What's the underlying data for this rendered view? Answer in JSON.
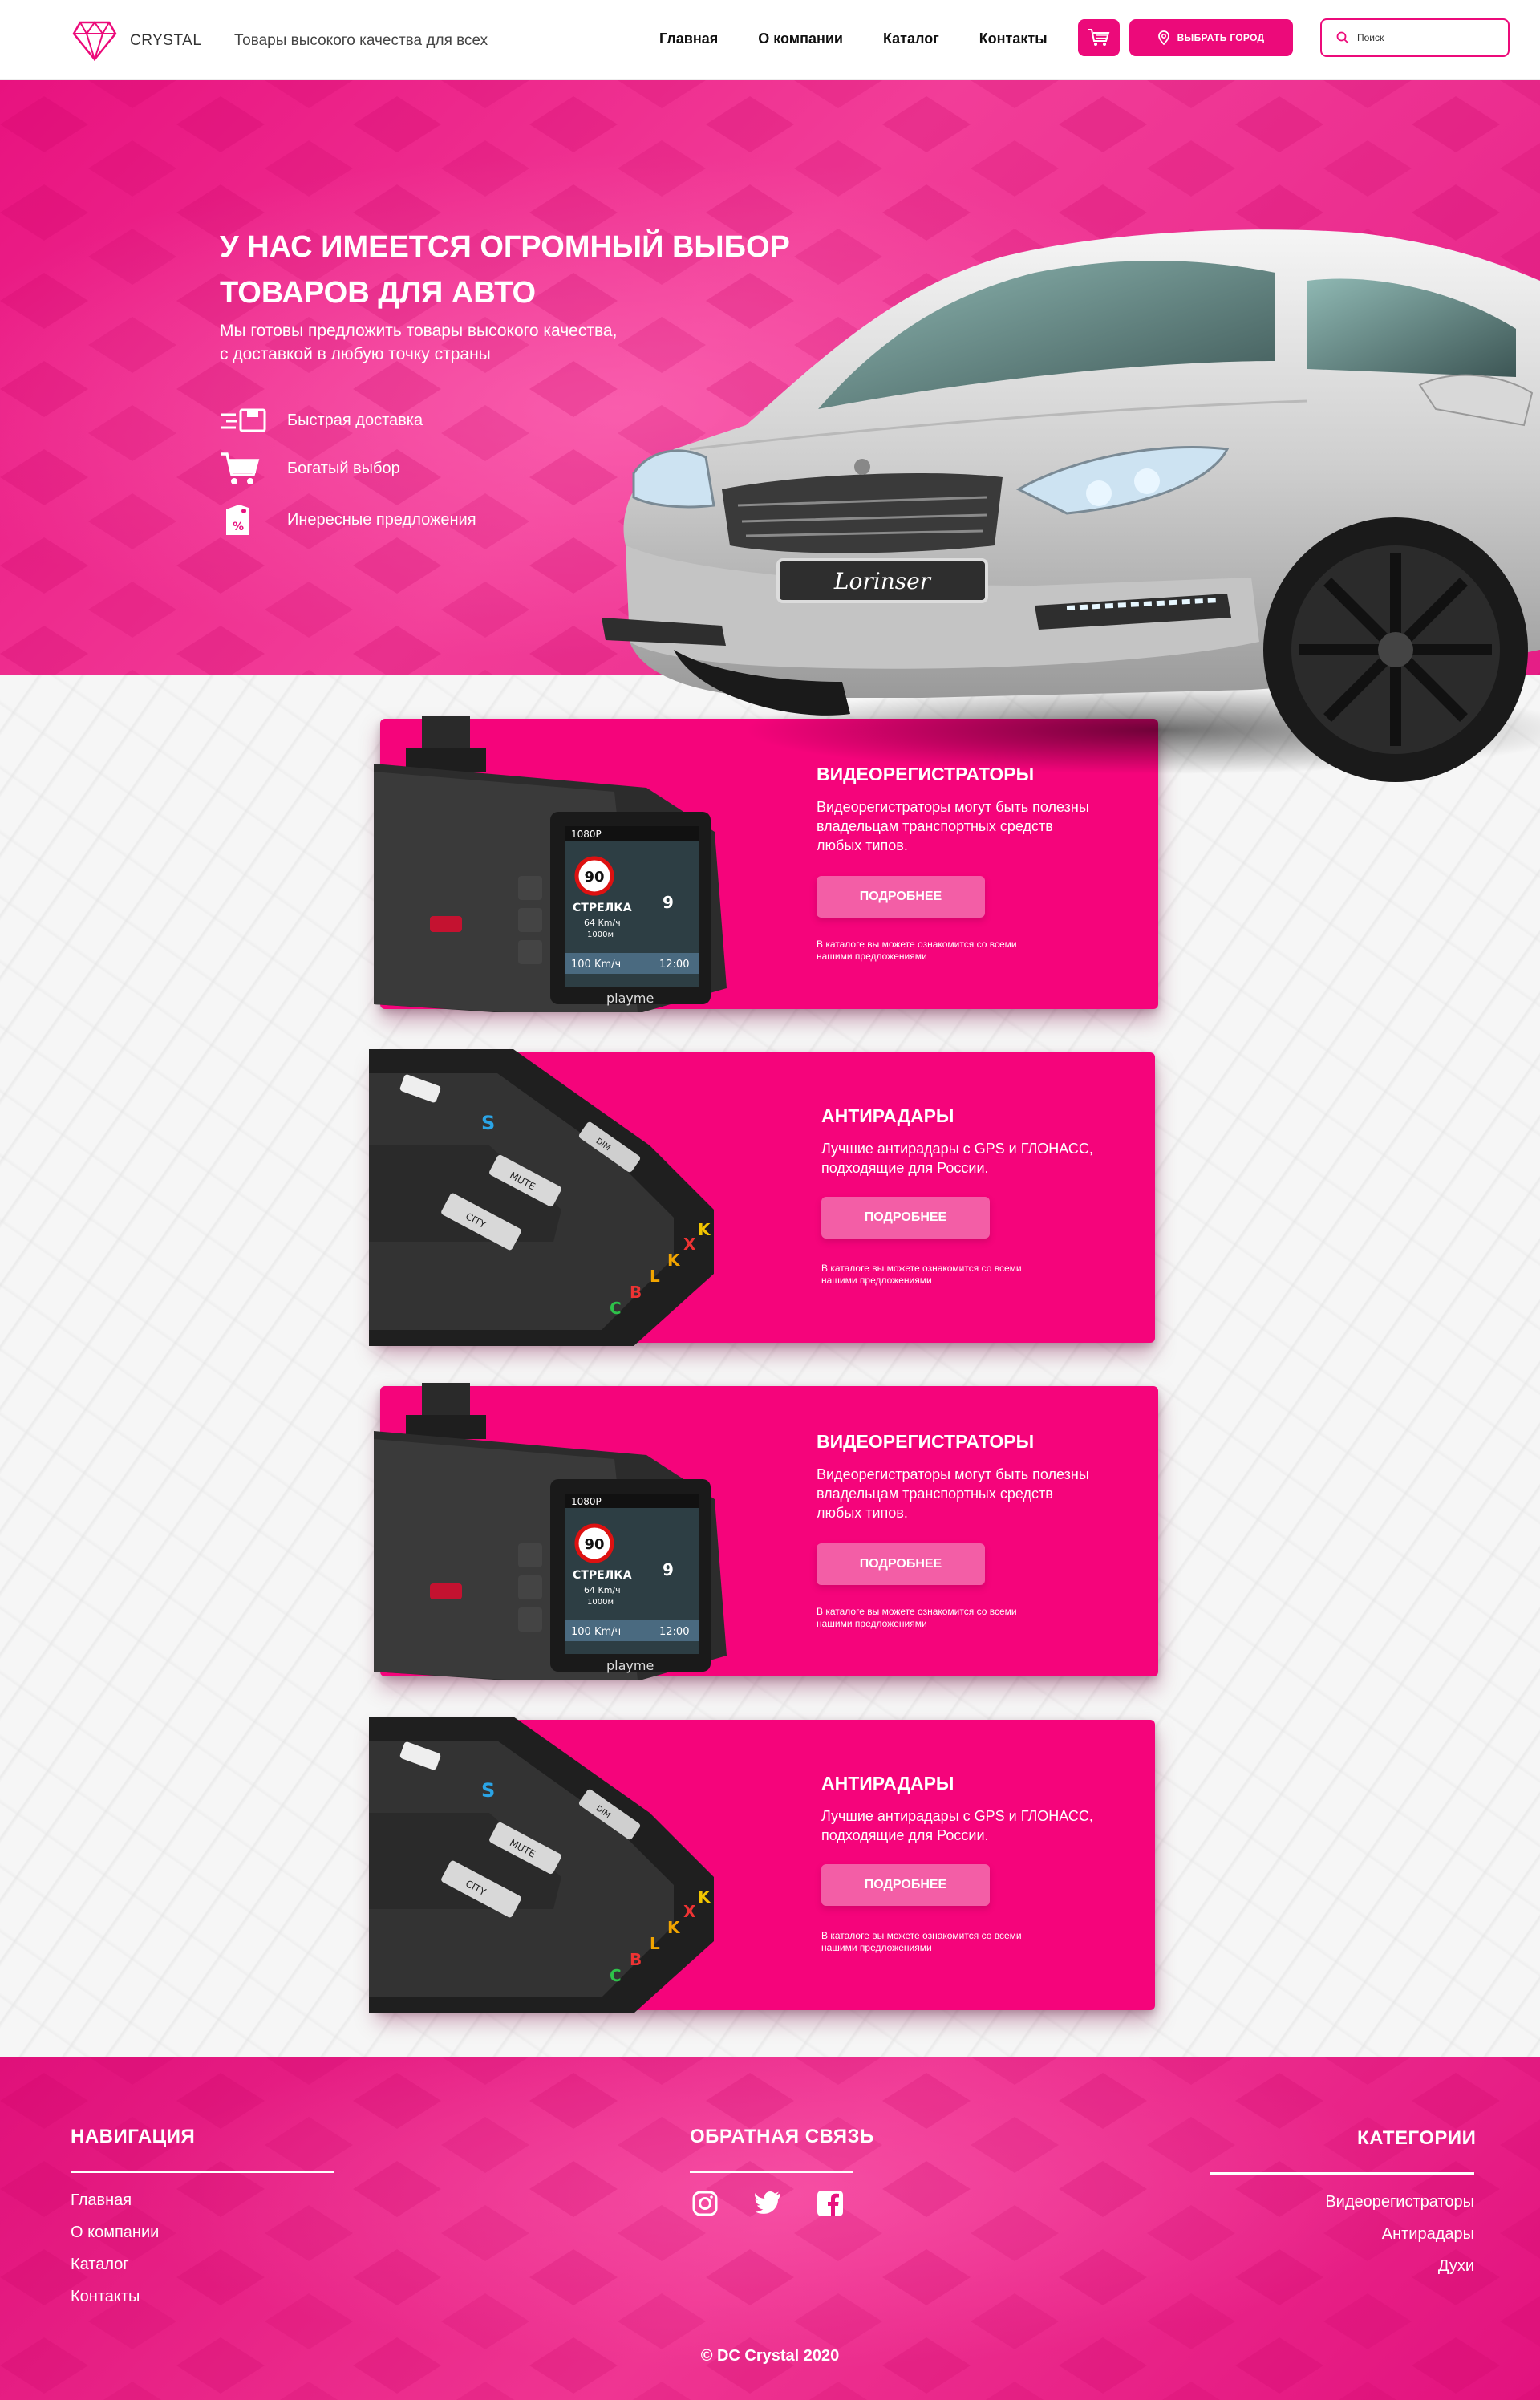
{
  "header": {
    "brand": "CRYSTAL",
    "tagline": "Товары высокого качества для всех",
    "nav": [
      "Главная",
      "О компании",
      "Каталог",
      "Контакты"
    ],
    "city_button": "ВЫБРАТЬ ГОРОД",
    "search_placeholder": "Поиск"
  },
  "hero": {
    "title_lines": [
      "У НАС ИМЕЕТСЯ ОГРОМНЫЙ ВЫБОР",
      "ТОВАРОВ ДЛЯ АВТО"
    ],
    "subtitle_lines": [
      "Мы готовы предложить товары высокого качества,",
      "с доставкой в любую точку страны"
    ],
    "features": [
      {
        "label": "Быстрая доставка",
        "icon": "fast-delivery-icon"
      },
      {
        "label": "Богатый выбор",
        "icon": "shopping-cart-icon"
      },
      {
        "label": "Инересные предложения",
        "icon": "discount-tag-icon"
      }
    ],
    "plate_text": "Lorinser"
  },
  "products": [
    {
      "title": "ВИДЕОРЕГИСТРАТОРЫ",
      "desc_lines": [
        "Видеорегистраторы могут быть полезны",
        "владельцам транспортных средств",
        "любых типов."
      ],
      "button": "ПОДРОБНЕЕ",
      "note_lines": [
        "В каталоге вы можете ознакомится со всеми",
        "нашими предложениями"
      ],
      "image": "dashcam"
    },
    {
      "title": "АНТИРАДАРЫ",
      "desc_lines": [
        "Лучшие антирадары с GPS и ГЛОНАСС,",
        "подходящие для России."
      ],
      "button": "ПОДРОБНЕЕ",
      "note_lines": [
        "В каталоге вы можете ознакомится со всеми",
        "нашими предложениями"
      ],
      "image": "radar-detector"
    },
    {
      "title": "ВИДЕОРЕГИСТРАТОРЫ",
      "desc_lines": [
        "Видеорегистраторы могут быть полезны",
        "владельцам транспортных средств",
        "любых типов."
      ],
      "button": "ПОДРОБНЕЕ",
      "note_lines": [
        "В каталоге вы можете ознакомится со всеми",
        "нашими предложениями"
      ],
      "image": "dashcam"
    },
    {
      "title": "АНТИРАДАРЫ",
      "desc_lines": [
        "Лучшие антирадары с GPS и ГЛОНАСС,",
        "подходящие для России."
      ],
      "button": "ПОДРОБНЕЕ",
      "note_lines": [
        "В каталоге вы можете ознакомится со всеми",
        "нашими предложениями"
      ],
      "image": "radar-detector"
    }
  ],
  "dashcam_screen": {
    "res": "1080P",
    "speed_limit": "90",
    "label": "СТРЕЛКА",
    "speed": "64 Km/ч",
    "dist": "1000м",
    "current": "100 Km/ч",
    "time": "12:00",
    "brand": "playme",
    "count": "9"
  },
  "radar_buttons": [
    "CITY",
    "MUTE",
    "DIM"
  ],
  "footer": {
    "nav_title": "НАВИГАЦИЯ",
    "nav_links": [
      "Главная",
      "О компании",
      "Каталог",
      "Контакты"
    ],
    "feedback_title": "ОБРАТНАЯ СВЯЗЬ",
    "social": [
      "instagram-icon",
      "twitter-icon",
      "facebook-icon"
    ],
    "categories_title": "КАТЕГОРИИ",
    "category_links": [
      "Видеорегистраторы",
      "Антирадары",
      "Духи"
    ],
    "copyright": "© DC Crystal 2020"
  },
  "colors": {
    "accent": "#ec0a7a",
    "card": "#f5047b",
    "button": "#f35ea6"
  }
}
